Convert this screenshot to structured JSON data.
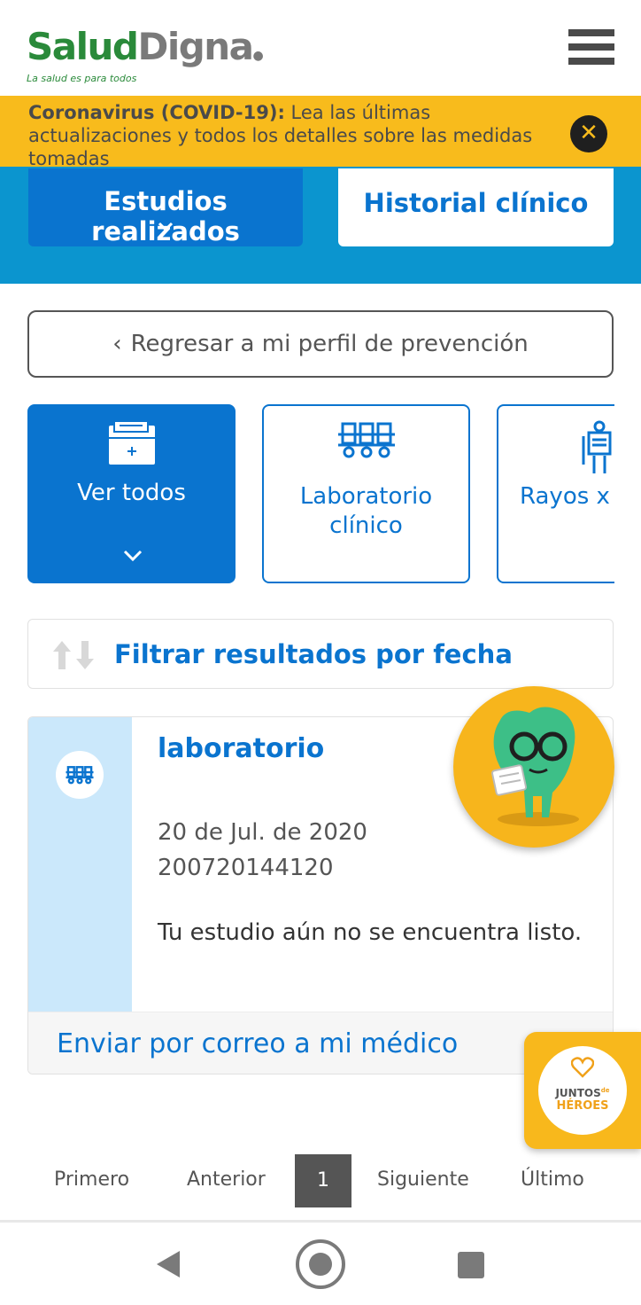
{
  "header": {
    "logo_salud": "Salud",
    "logo_digna": "Digna",
    "logo_tagline": "La salud es para todos"
  },
  "banner": {
    "bold": "Coronavirus (COVID-19):",
    "text": " Lea las últimas actualizaciones y todos los detalles sobre las medidas tomadas"
  },
  "tabs": {
    "active": "Estudios realizados",
    "inactive": "Historial clínico"
  },
  "back_button": "Regresar a mi perfil de prevención",
  "categories": [
    {
      "label": "Ver todos",
      "icon": "folder-icon"
    },
    {
      "label": "Laboratorio clínico",
      "icon": "lab-rack-icon"
    },
    {
      "label": "Rayos x",
      "icon": "xray-icon"
    }
  ],
  "filter": {
    "label": "Filtrar resultados por fecha"
  },
  "result": {
    "type": "laboratorio",
    "date": "20 de Jul. de 2020",
    "folio": "200720144120",
    "status": "Tu estudio aún no se encuentra listo.",
    "send_link": "Enviar por correo a mi médico"
  },
  "heroes": {
    "line1": "JUNTOS",
    "de": "de",
    "line2": "HÉROES"
  },
  "pagination": {
    "first": "Primero",
    "prev": "Anterior",
    "current": "1",
    "next": "Siguiente",
    "last": "Último"
  },
  "colors": {
    "brand_green": "#2a8a3a",
    "brand_blue": "#0a74cf",
    "band_blue": "#0b95cf",
    "banner_yellow": "#f8bb1c",
    "side_light_blue": "#cbe8fb"
  }
}
